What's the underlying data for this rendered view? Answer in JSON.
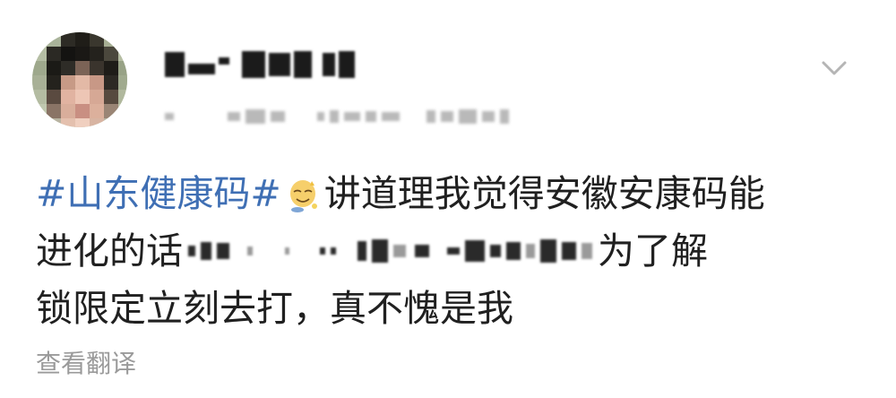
{
  "post": {
    "hashtag": "#山东健康码#",
    "emoji_icon": "sweat-smile-emoji-icon",
    "line1_text": "讲道理我觉得安徽安康码能",
    "line2_prefix": "进化的话",
    "line2_suffix": "为了解",
    "line3_text": "锁限定立刻去打，真不愧是我",
    "translate_label": "查看翻译"
  },
  "colors": {
    "hashtag": "#3f6fb4",
    "body_text": "#202020",
    "muted_text": "#9a9a9a",
    "chevron": "#b5b5b5"
  }
}
